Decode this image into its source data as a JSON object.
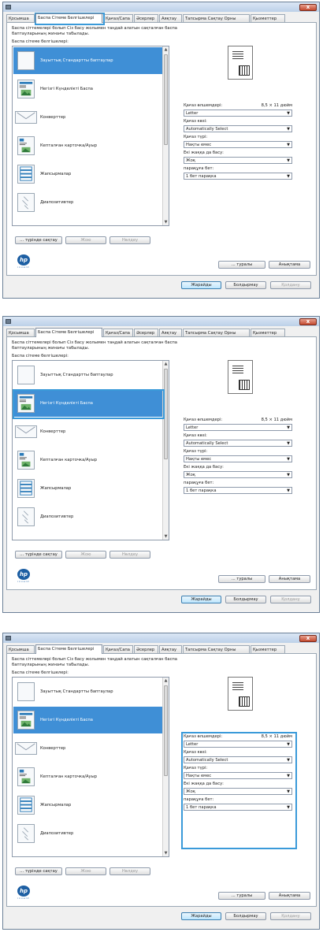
{
  "dialog": {
    "close_label": "x",
    "tabs": [
      "Қосымша",
      "Баспа Сітеме Белгішелері",
      "Қағаз/Сапа",
      "Әсерлер",
      "Аяқтау",
      "Тапсырма Сақтау Орны",
      "Қызметтер"
    ],
    "description": "Баспа сіттемелері болып Сіз басу жолымен таңдай алатын сақталған баспа баптауларының жинағы табылады.",
    "shortcuts_label": "Баспа сітеме белгішелері:",
    "shortcuts": [
      {
        "label": "Зауыттық Стандартты баптаулар",
        "icon": "blank-page-icon"
      },
      {
        "label": "Негізгі Күнделікті Баспа",
        "icon": "everyday-print-icon"
      },
      {
        "label": "Конверттер",
        "icon": "envelope-icon"
      },
      {
        "label": "Кепталған карточка/Ауыр",
        "icon": "card-stock-icon"
      },
      {
        "label": "Жапсырмалар",
        "icon": "labels-icon"
      },
      {
        "label": "Диапозитивтер",
        "icon": "transparency-icon"
      }
    ],
    "paper_size_label": "Қағаз өлшемдері:",
    "paper_size_dims": "8,5 × 11 дюйм",
    "paper_size_value": "Letter",
    "paper_source_label": "Қағаз көзі:",
    "paper_source_value": "Automatically Select",
    "paper_type_label": "Қағаз түрі:",
    "paper_type_value": "Нақты емес",
    "duplex_label": "Екі жаққа да басу:",
    "duplex_value": "Жоқ",
    "pages_label": "парақұға бет:",
    "pages_value": "1 бет парақка",
    "save_as_button": "... түрінде сақтау",
    "delete_button": "Жою",
    "reset_button": "Нөлдеу",
    "about_button": "... туралы",
    "help_button": "Анықтама",
    "ok_button": "Жарайды",
    "cancel_button": "Болдырмау",
    "apply_button": "Қолдану",
    "hp_logo": "hp",
    "hp_tagline": "invent"
  },
  "steps": [
    {
      "highlight": "tab-printing-shortcuts",
      "selected_index": 0
    },
    {
      "highlight": "shortcut-everyday",
      "selected_index": 1
    },
    {
      "highlight": "settings-panel",
      "selected_index": 1
    }
  ],
  "colors": {
    "highlight": "#3a9ad9",
    "selection": "#3f8fd6"
  }
}
